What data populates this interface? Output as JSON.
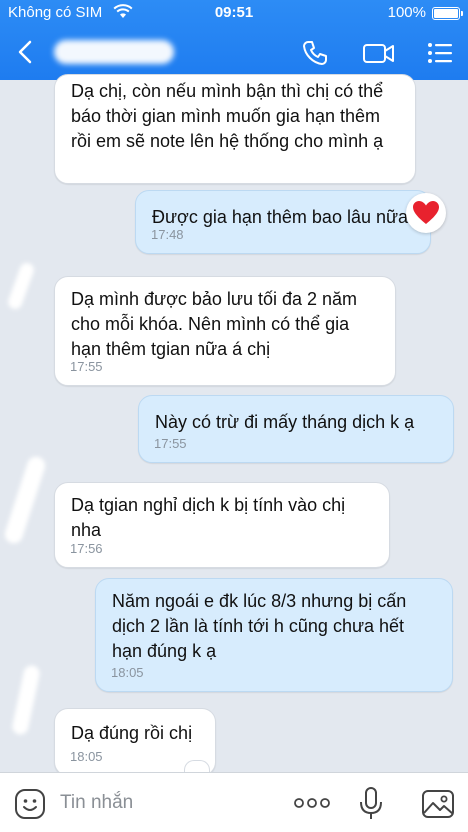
{
  "status_bar": {
    "carrier": "Không có SIM",
    "time": "09:51",
    "battery": "100%"
  },
  "header": {
    "contact_name": "",
    "icons": [
      "back-icon",
      "phone-icon",
      "video-camera-icon",
      "menu-icon"
    ]
  },
  "messages": [
    {
      "side": "in",
      "text": "Dạ chị, còn nếu mình bận thì chị có thể báo thời gian mình muốn gia hạn thêm rồi em sẽ note lên hệ thống cho mình ạ",
      "time": ""
    },
    {
      "side": "out",
      "text": "Được gia hạn thêm bao lâu nữa",
      "time": "17:48",
      "reaction": "heart"
    },
    {
      "side": "in",
      "text": "Dạ mình được bảo lưu tối đa 2 năm cho mỗi khóa. Nên mình có thể gia hạn thêm tgian nữa á chị",
      "time": "17:55"
    },
    {
      "side": "out",
      "text": "Này có trừ đi mấy tháng dịch k ạ",
      "time": "17:55"
    },
    {
      "side": "in",
      "text": "Dạ tgian nghỉ dịch k bị tính vào chị nha",
      "time": "17:56"
    },
    {
      "side": "out",
      "text": "Năm ngoái e đk lúc 8/3 nhưng bị cấn dịch 2 lần là tính tới h cũng chưa hết hạn đúng k ạ",
      "time": "18:05"
    },
    {
      "side": "in",
      "text": "Dạ đúng rồi chị",
      "time": "18:05"
    }
  ],
  "input_bar": {
    "placeholder": "Tin nhắn"
  },
  "colors": {
    "header": "#1e7cf0",
    "outgoing_bubble": "#d7ecfd",
    "incoming_bubble": "#ffffff",
    "background": "#e3e8ef",
    "heart": "#e8222e"
  }
}
